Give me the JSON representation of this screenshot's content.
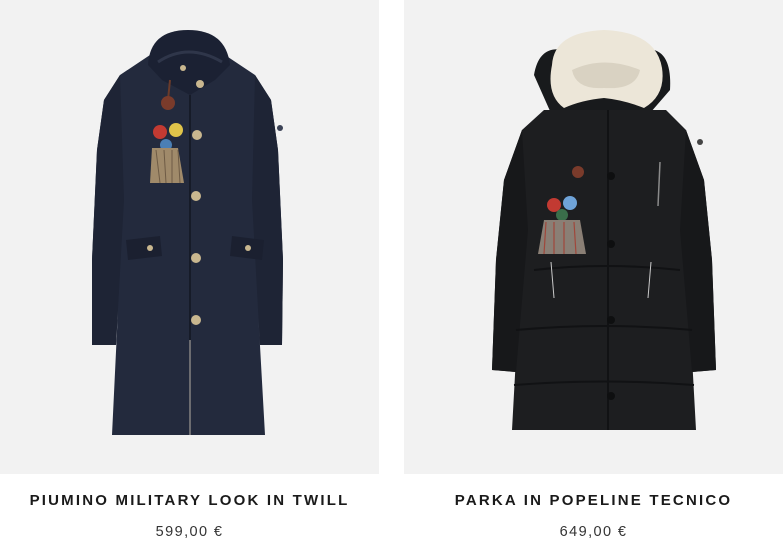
{
  "products": [
    {
      "name": "PIUMINO MILITARY LOOK IN TWILL",
      "price": "599,00 €",
      "image_icon": "navy-coat-photo",
      "coat_color": "#232a3d"
    },
    {
      "name": "PARKA IN POPELINE TECNICO",
      "price": "649,00 €",
      "image_icon": "black-parka-photo",
      "coat_color": "#1d1e20"
    }
  ],
  "colors": {
    "photo_background": "#f2f2f2",
    "text": "#1a1a1a"
  }
}
